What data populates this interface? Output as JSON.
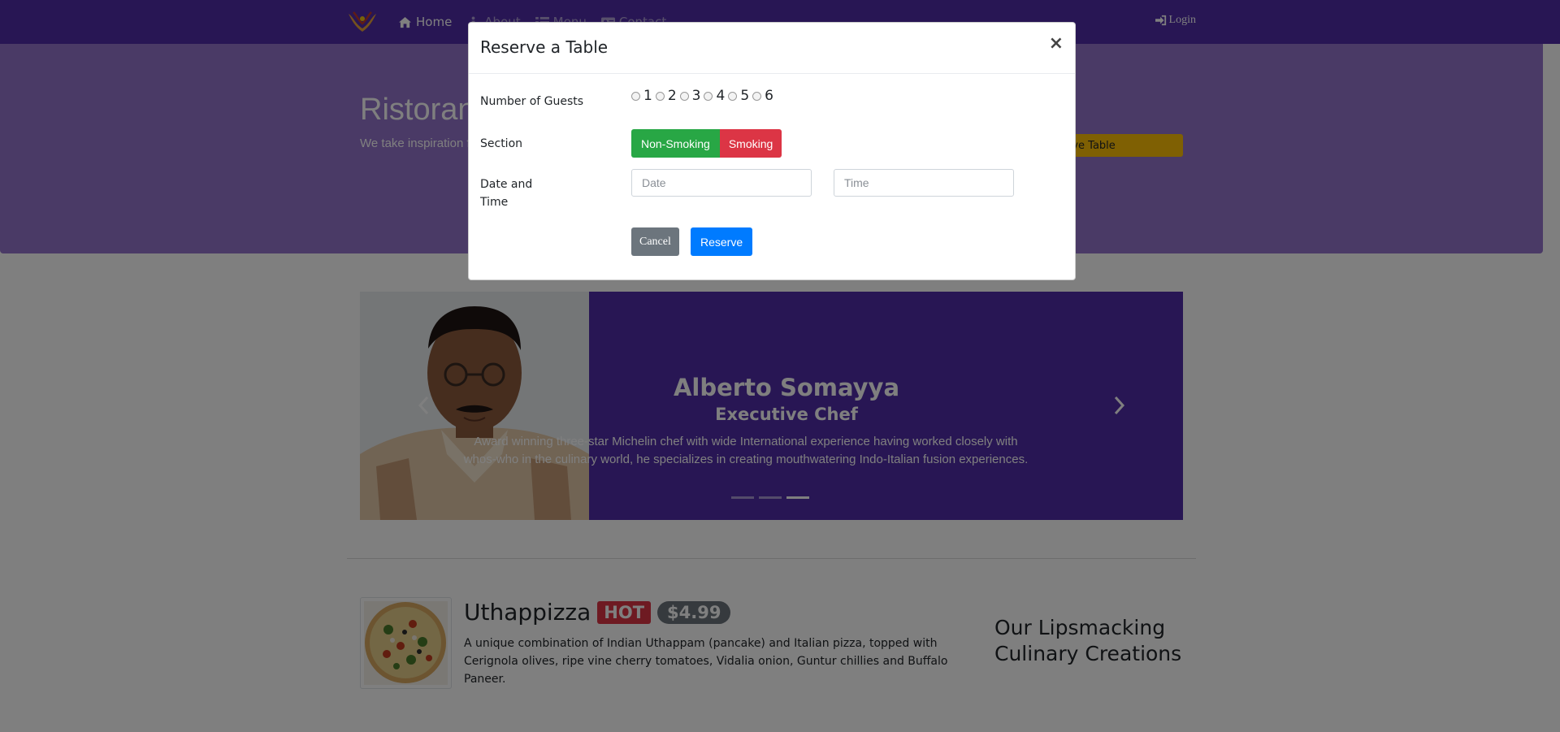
{
  "colors": {
    "navbar": "#512da8",
    "jumbotron": "#9575cd",
    "carousel": "#512da8",
    "non_smoking": "#28a745",
    "smoking": "#dc3545",
    "reserve_btn": "#007bff",
    "cancel_btn": "#6c757d",
    "reserve_table_btn": "#ffc107"
  },
  "navbar": {
    "brand_icon": "logo-icon",
    "items": [
      {
        "label": "Home",
        "icon": "home-icon"
      },
      {
        "label": "About",
        "icon": "info-icon"
      },
      {
        "label": "Menu",
        "icon": "list-icon"
      },
      {
        "label": "Contact",
        "icon": "address-card-icon"
      }
    ],
    "login": {
      "label": "Login",
      "icon": "sign-in-icon"
    }
  },
  "jumbotron": {
    "title": "Ristoran",
    "text": "We take inspiration fusion experience. C senses!",
    "reserve_button": "rve Table"
  },
  "carousel": {
    "name": "Alberto Somayya",
    "role": "Executive Chef",
    "description": "Award winning three-star Michelin chef with wide International experience having worked closely with whos-who in the culinary world, he specializes in creating mouthwatering Indo-Italian fusion experiences.",
    "slide_count": 3,
    "active_index": 2
  },
  "dish": {
    "name": "Uthappizza",
    "badge": "HOT",
    "price": "$4.99",
    "description": "A unique combination of Indian Uthappam (pancake) and Italian pizza, topped with Cerignola olives, ripe vine cherry tomatoes, Vidalia onion, Guntur chillies and Buffalo Paneer.",
    "side_heading": "Our Lipsmacking Culinary Creations"
  },
  "modal": {
    "title": "Reserve a Table",
    "close": "×",
    "guests_label": "Number of Guests",
    "guest_options": [
      "1",
      "2",
      "3",
      "4",
      "5",
      "6"
    ],
    "section_label": "Section",
    "non_smoking": "Non-Smoking",
    "smoking": "Smoking",
    "datetime_label": "Date and Time",
    "date_placeholder": "Date",
    "time_placeholder": "Time",
    "cancel": "Cancel",
    "reserve": "Reserve"
  }
}
